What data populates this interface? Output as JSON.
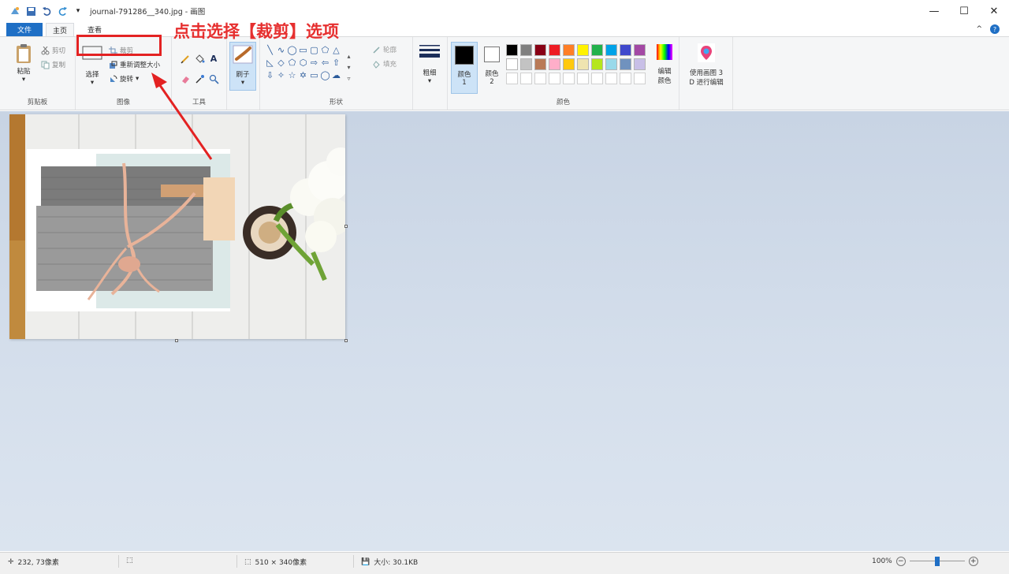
{
  "window": {
    "title": "journal-791286__340.jpg - 画图",
    "qa_more": "▾",
    "controls": {
      "minimize": "—",
      "maximize": "☐",
      "close": "✕"
    }
  },
  "tabs": {
    "file": "文件",
    "home": "主页",
    "view": "查看",
    "collapse": "^",
    "help": "?"
  },
  "ribbon": {
    "clipboard": {
      "label": "剪贴板",
      "paste": "粘贴",
      "paste_arrow": "▾",
      "cut": "剪切",
      "copy": "复制"
    },
    "image": {
      "label": "图像",
      "select": "选择",
      "select_arrow": "▾",
      "crop": "裁剪",
      "resize": "重新调整大小",
      "rotate": "旋转",
      "rotate_arrow": "▾"
    },
    "tools": {
      "label": "工具"
    },
    "brush": {
      "label": "刷子",
      "arrow": "▾"
    },
    "shapes": {
      "label": "形状",
      "outline": "轮廓",
      "fill": "填充"
    },
    "size": {
      "label": "粗细",
      "arrow": "▾"
    },
    "colors": {
      "label": "颜色",
      "color1": "颜色 1",
      "color2": "颜色 2",
      "edit": "编辑颜色",
      "primary": "#000000",
      "secondary": "#ffffff",
      "palette_row1": [
        "#000000",
        "#7f7f7f",
        "#880015",
        "#ed1c24",
        "#ff7f27",
        "#fff200",
        "#22b14c",
        "#00a2e8",
        "#3f48cc",
        "#a349a4"
      ],
      "palette_row2": [
        "#ffffff",
        "#c3c3c3",
        "#b97a57",
        "#ffaec9",
        "#ffc90e",
        "#efe4b0",
        "#b5e61d",
        "#99d9ea",
        "#7092be",
        "#c8bfe7"
      ]
    },
    "paint3d": {
      "line1": "使用画图 3",
      "line2": "D 进行编辑"
    }
  },
  "annotation": {
    "text": "点击选择【裁剪】选项"
  },
  "status": {
    "cursor_pos": "232, 73像素",
    "image_size": "510 × 340像素",
    "file_size": "大小: 30.1KB",
    "zoom": "100%",
    "zoom_out": "−",
    "zoom_in": "+",
    "zoom_level": 0.5
  }
}
